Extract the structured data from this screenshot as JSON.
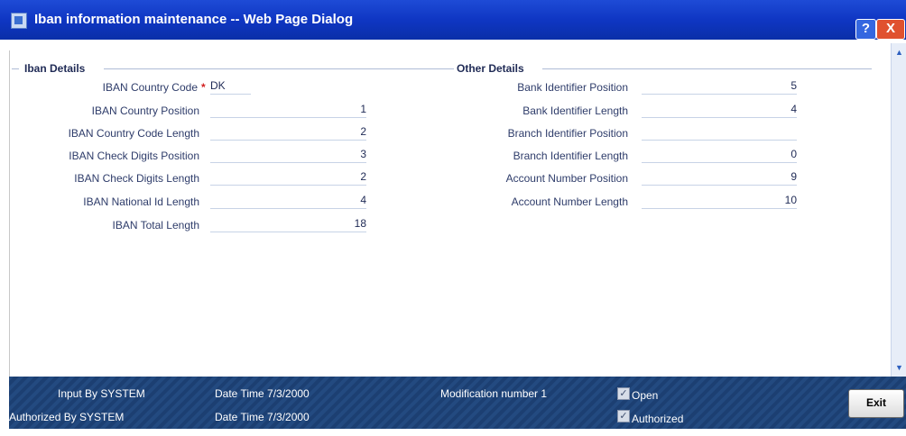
{
  "window": {
    "title": "Iban information maintenance -- Web Page Dialog",
    "help_glyph": "?",
    "close_glyph": "X"
  },
  "iban_details": {
    "header": "Iban Details",
    "fields": [
      {
        "label": "IBAN Country Code",
        "value": "DK",
        "required": true
      },
      {
        "label": "IBAN Country Position",
        "value": "1"
      },
      {
        "label": "IBAN Country Code Length",
        "value": "2"
      },
      {
        "label": "IBAN Check Digits Position",
        "value": "3"
      },
      {
        "label": "IBAN Check Digits Length",
        "value": "2"
      },
      {
        "label": "IBAN National Id Length",
        "value": "4"
      },
      {
        "label": "IBAN Total Length",
        "value": "18"
      }
    ]
  },
  "other_details": {
    "header": "Other Details",
    "fields": [
      {
        "label": "Bank Identifier Position",
        "value": "5"
      },
      {
        "label": "Bank Identifier Length",
        "value": "4"
      },
      {
        "label": "Branch Identifier Position",
        "value": ""
      },
      {
        "label": "Branch Identifier Length",
        "value": "0"
      },
      {
        "label": "Account Number Position",
        "value": "9"
      },
      {
        "label": "Account Number Length",
        "value": "10"
      }
    ]
  },
  "footer": {
    "input_by": "Input By SYSTEM",
    "input_datetime": "Date Time 7/3/2000",
    "authorized_by": "Authorized By SYSTEM",
    "authorized_datetime": "Date Time 7/3/2000",
    "modification": "Modification number 1",
    "open_label": "Open",
    "open_checked": true,
    "authorized_label": "Authorized",
    "authorized_checked": true,
    "exit_label": "Exit"
  },
  "required_marker": "*",
  "check_glyph": "✓",
  "scroll": {
    "up": "▲",
    "down": "▼"
  },
  "colors": {
    "titlebar": "#0f36c3",
    "footer": "#1c3f72",
    "required": "#d21f1f"
  }
}
